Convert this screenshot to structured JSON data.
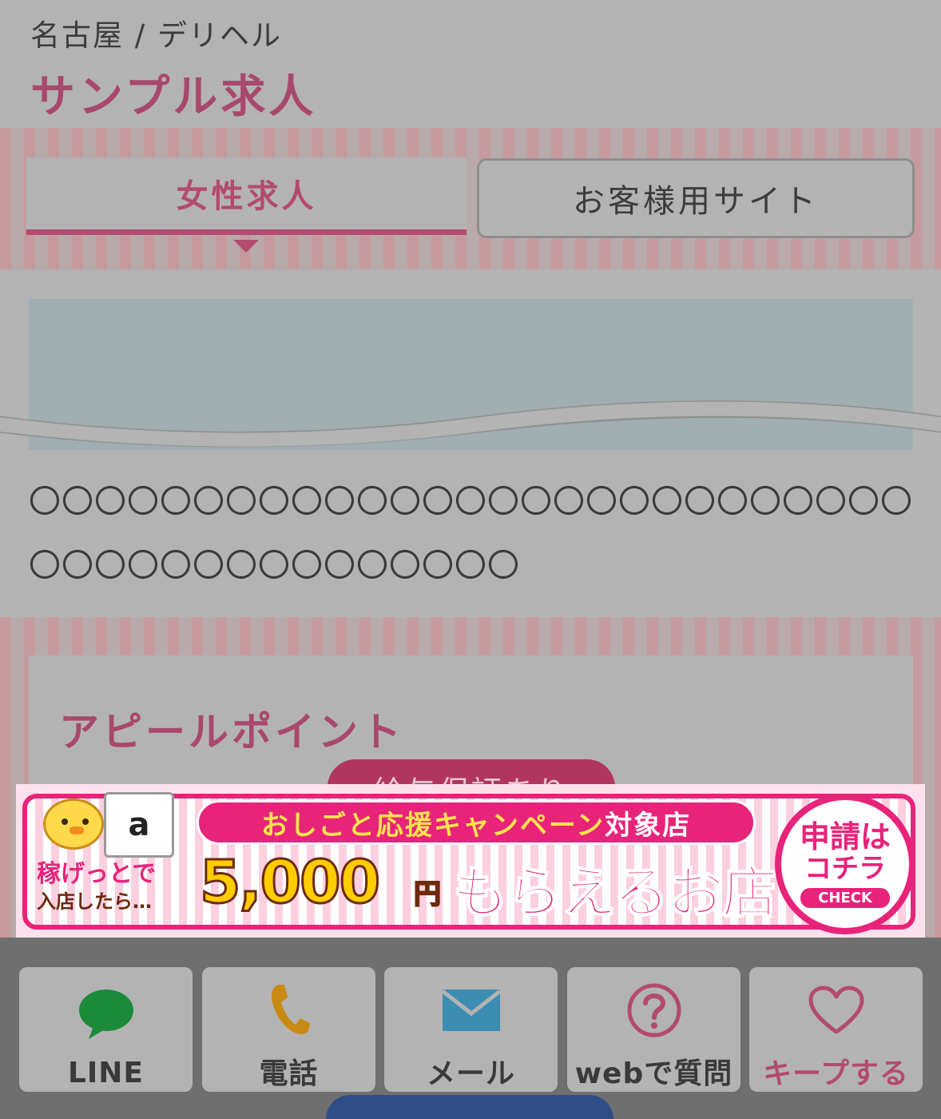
{
  "breadcrumb": "名古屋 / デリヘル",
  "page_title": "サンプル求人",
  "tabs": {
    "women": "女性求人",
    "customer": "お客様用サイト"
  },
  "description": "〇〇〇〇〇〇〇〇〇〇〇〇〇〇〇〇〇〇〇〇〇〇〇〇〇〇〇〇〇〇〇〇〇〇〇〇〇〇〇〇〇〇",
  "appeal": {
    "title": "アピールポイント",
    "badge": "給与保証あり"
  },
  "banner": {
    "headline_main": "おしごと応援キャンペーン",
    "headline_suffix": "対象店",
    "earn_line1": "稼げっとで",
    "earn_line2": "入店したら…",
    "amount": "5,000",
    "yen": "円",
    "tagline": "もらえるお店",
    "apply_main": "申請は",
    "apply_sub": "コチラ",
    "apply_check": "CHECK",
    "amazon_letter": "a"
  },
  "actions": [
    {
      "label": "LINE",
      "icon": "line-chat-icon",
      "color": "#1b8a3a"
    },
    {
      "label": "電話",
      "icon": "phone-icon",
      "color": "#c88a12"
    },
    {
      "label": "メール",
      "icon": "mail-icon",
      "color": "#3d8db3"
    },
    {
      "label": "webで質問",
      "icon": "question-icon",
      "color": "#b34a70"
    },
    {
      "label": "キープする",
      "icon": "heart-icon",
      "color": "#b34a70"
    }
  ],
  "colors": {
    "accent": "#b34a70",
    "banner_pink": "#e8237a",
    "overlay_gray": "#b3b3b3"
  }
}
